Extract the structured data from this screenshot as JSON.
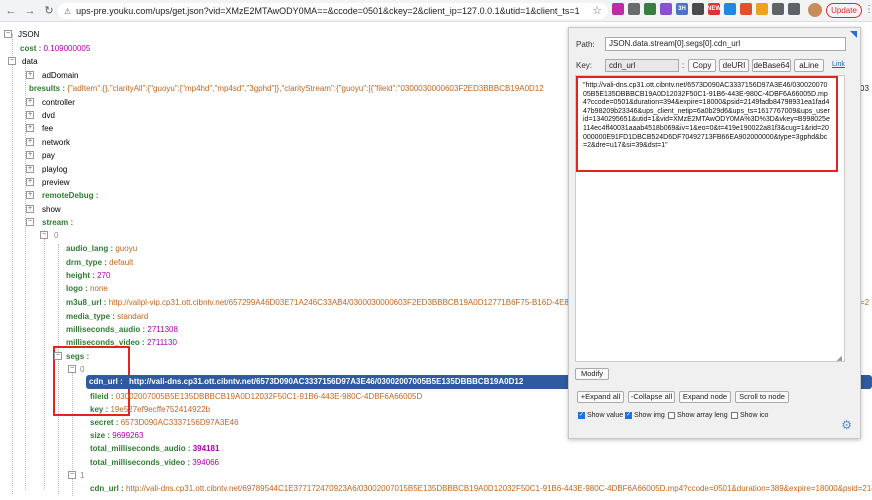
{
  "browser": {
    "url": "ups-pre.youku.com/ups/get.json?vid=XMzE2MTAwODY0MA==&ccode=0501&ckey=2&client_ip=127.0.0.1&utid=1&client_ts=1",
    "update_label": "Update",
    "extensions": [
      {
        "label": "",
        "color": "#c02aa8"
      },
      {
        "label": "",
        "color": "#6b6b6b"
      },
      {
        "label": "",
        "color": "#3a7d44"
      },
      {
        "label": "",
        "color": "#8a4fd3"
      },
      {
        "label": "3H",
        "color": "#4a73c9"
      },
      {
        "label": "",
        "color": "#4a4a4a"
      },
      {
        "label": "NEW",
        "color": "#d33"
      },
      {
        "label": "",
        "color": "#1e88e5"
      },
      {
        "label": "",
        "color": "#e5502b"
      },
      {
        "label": "",
        "color": "#f0a21a"
      },
      {
        "label": "",
        "color": "#5f6368"
      },
      {
        "label": "",
        "color": "#5f6368"
      }
    ]
  },
  "tree": {
    "root_label": "JSON",
    "cost": {
      "key": "cost :",
      "value": "0.109000005"
    },
    "data_key": "data",
    "adDomain": "adDomain",
    "bresults": {
      "key": "bresults :",
      "value": "{\"adItem\":{},\"clarityAll\":{\"guoyu\":[\"mp4hd\",\"mp4sd\",\"3gphd\"]},\"clarityStream\":{\"guoyu\":[{\"fileid\":\"0300030000603F2ED3BBBCB19A0D12"
    },
    "controller": "controller",
    "dvd": "dvd",
    "fee": "fee",
    "network": "network",
    "pay": "pay",
    "playlog": "playlog",
    "preview": "preview",
    "remoteDebug": "remoteDebug :",
    "show": "show",
    "stream": "stream :",
    "idx0": "0",
    "audio_lang": {
      "key": "audio_lang :",
      "value": "guoyu"
    },
    "drm_type": {
      "key": "drm_type :",
      "value": "default"
    },
    "height": {
      "key": "height :",
      "value": "270"
    },
    "logo": {
      "key": "logo :",
      "value": "none"
    },
    "m3u8_url": {
      "key": "m3u8_url :",
      "value": "http://valipl-vip.cp31.ott.cibntv.net/657299A46D03E71A246C33AB4/0300030000603F2ED3BBBCB19A0D12771B6F75-B16D-4E8C-A"
    },
    "media_type": {
      "key": "media_type :",
      "value": "standard"
    },
    "ms_audio": {
      "key": "milliseconds_audio :",
      "value": "2711308"
    },
    "ms_video": {
      "key": "milliseconds_video :",
      "value": "2711130"
    },
    "segs": "segs :",
    "segs_idx0": "0",
    "cdn_url": {
      "key": "cdn_url :",
      "value": "http://vali-dns.cp31.ott.cibntv.net/6573D090AC3337156D97A3E46/03002007005B5E135DBBBCB19A0D12"
    },
    "fileid": {
      "key": "fileid :",
      "value": "03002007005B5E135DBBBCB19A0D12032F50C1-91B6-443E-980C-4DBF6A66005D"
    },
    "keyf": {
      "key": "key :",
      "value": "19e527ef9ecffe752414922b"
    },
    "secret": {
      "key": "secret :",
      "value": "6573D090AC3337156D97A3E46"
    },
    "size": {
      "key": "size :",
      "value": "9699263"
    },
    "tma": {
      "key": "total_milliseconds_audio :",
      "value": "394181"
    },
    "tmv": {
      "key": "total_milliseconds_video :",
      "value": "394066"
    },
    "segs_idx1": "1",
    "cdn_url2": {
      "key": "cdn_url :",
      "value": "http://vali-dns.cp31.ott.cibntv.net/69789544C1E377172470923A6/03002007015B5E135DBBBCB19A0D12032F50C1-91B6-443E-980C-4DBF6A66005D.mp4?ccode=0501&duration=389&expire=18000&psid=2149fadb8"
    },
    "right_cut": "=2",
    "right_cut2": "03",
    "right_cut3": "&"
  },
  "panel": {
    "path_label": "Path:",
    "path_value": "JSON.data.stream[0].segs[0].cdn_url",
    "key_label": "Key:",
    "key_value": "cdn_url",
    "buttons": [
      "Copy",
      "deURI",
      "deBase64",
      "aLine"
    ],
    "link": "Link",
    "content": "\"http://vali-dns.cp31.ott.cibntv.net/6573D090AC3337156D97A3E46/03002007005B5E135DBBBCB19A0D12032F50C1-91B6-443E-980C-4DBF6A66005D.mp4?ccode=0501&duration=394&expire=18000&psid=2149fadb84798931ea1fad447b98209b23346&ups_client_netip=6a0b29d6&ups_ts=1617767009&ups_userid=1340295651&utid=1&vid=XMzE2MTAwODY0MA%3D%3D&vkey=B998025e114ec4ff40031aaab4518b069&iv=1&eo=0&t=419e190022a81f3&cug=1&rid=20000000E91FD1DBCB524D6DF70492713FB66EA902000000&type=3gphd&bc=2&dre=u17&si=39&dst=1\"",
    "modify": "Modify",
    "expand_all": "+Expand all",
    "collapse_all": "-Collapse all",
    "expand_node": "Expand node",
    "scroll_to_node": "Scroll to node",
    "checkboxes": [
      {
        "label": "Show value",
        "checked": true
      },
      {
        "label": "Show img",
        "checked": true
      },
      {
        "label": "Show array leng",
        "checked": false
      },
      {
        "label": "Show ico",
        "checked": false
      }
    ]
  }
}
